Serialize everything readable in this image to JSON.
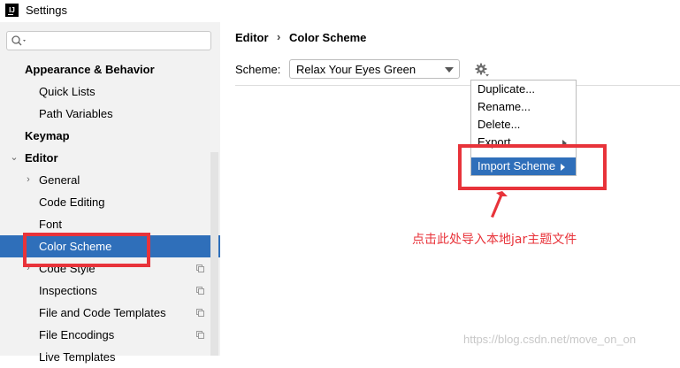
{
  "window": {
    "title": "Settings",
    "logo_text": "IJ"
  },
  "sidebar": {
    "search": {
      "value": "",
      "placeholder": ""
    },
    "items": [
      {
        "label": "Appearance & Behavior"
      },
      {
        "label": "Quick Lists"
      },
      {
        "label": "Path Variables"
      },
      {
        "label": "Keymap"
      },
      {
        "label": "Editor"
      },
      {
        "label": "General"
      },
      {
        "label": "Code Editing"
      },
      {
        "label": "Font"
      },
      {
        "label": "Color Scheme"
      },
      {
        "label": "Code Style"
      },
      {
        "label": "Inspections"
      },
      {
        "label": "File and Code Templates"
      },
      {
        "label": "File Encodings"
      },
      {
        "label": "Live Templates"
      }
    ]
  },
  "main": {
    "breadcrumb": {
      "parent": "Editor",
      "separator": "›",
      "current": "Color Scheme"
    },
    "scheme_label": "Scheme:",
    "scheme_value": "Relax Your Eyes Green"
  },
  "menu": {
    "items": [
      {
        "label": "Duplicate..."
      },
      {
        "label": "Rename..."
      },
      {
        "label": "Delete..."
      },
      {
        "label": "Export"
      },
      {
        "label": "Import Scheme"
      }
    ]
  },
  "annotation": {
    "text": "点击此处导入本地jar主题文件"
  },
  "watermark": "https://blog.csdn.net/move_on_on",
  "colors": {
    "selection": "#2f6fba",
    "annotation_red": "#e8333a",
    "sidebar_bg": "#f2f2f2"
  }
}
